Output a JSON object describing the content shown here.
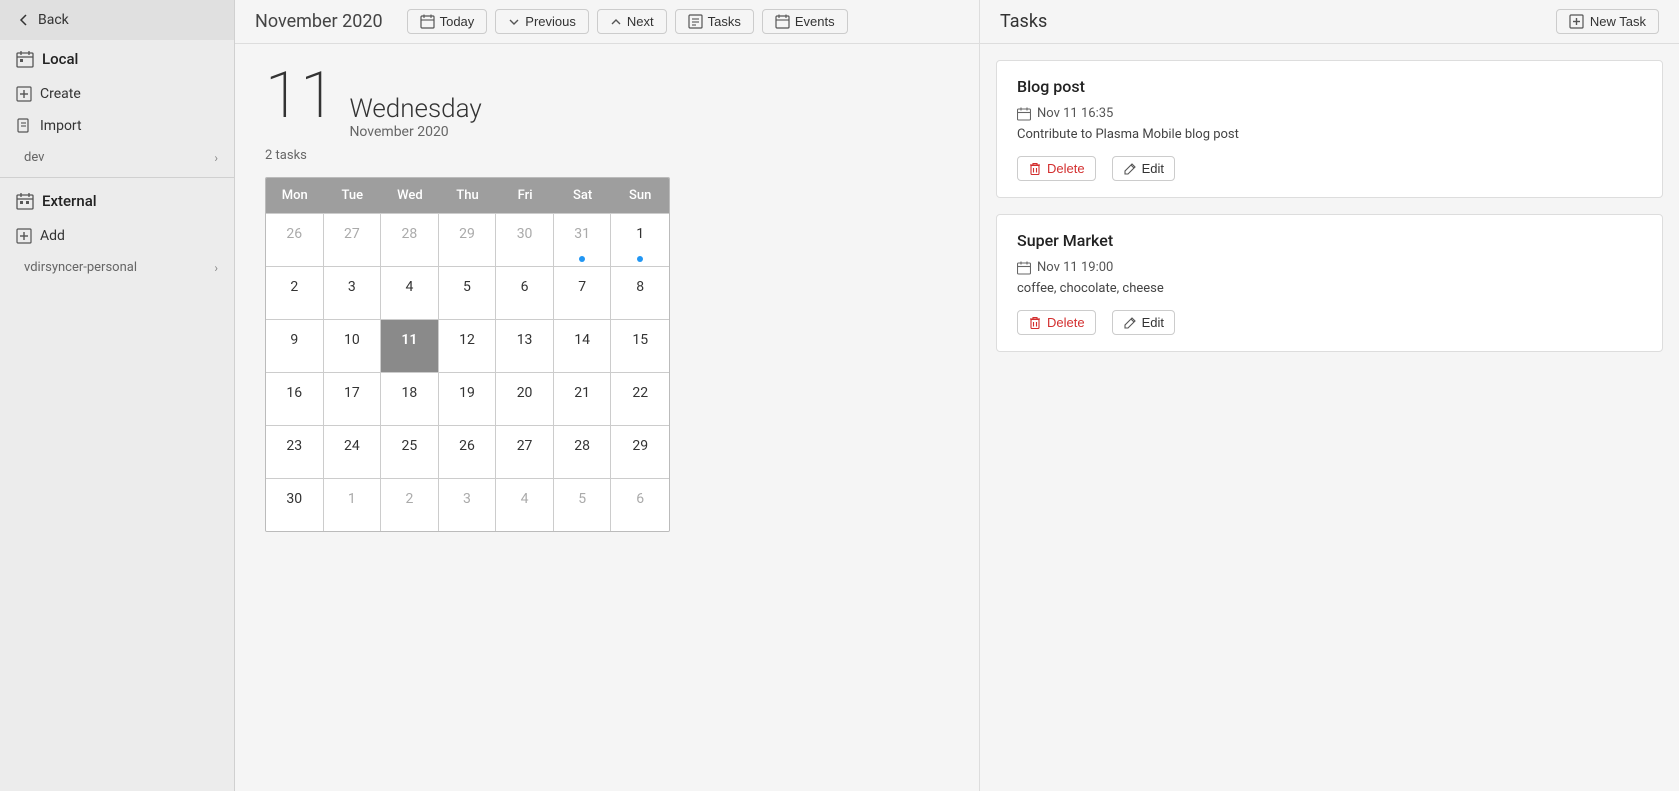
{
  "sidebar": {
    "back_label": "Back",
    "local_label": "Local",
    "create_label": "Create",
    "import_label": "Import",
    "dev_label": "dev",
    "external_label": "External",
    "add_label": "Add",
    "vdirsyncer_label": "vdirsyncer-personal"
  },
  "topbar": {
    "title": "November 2020",
    "today_label": "Today",
    "previous_label": "Previous",
    "next_label": "Next",
    "tasks_label": "Tasks",
    "events_label": "Events"
  },
  "date_display": {
    "number": "11",
    "weekday": "Wednesday",
    "month": "November 2020",
    "tasks_count": "2 tasks"
  },
  "calendar": {
    "headers": [
      "Mon",
      "Tue",
      "Wed",
      "Thu",
      "Fri",
      "Sat",
      "Sun"
    ],
    "rows": [
      [
        {
          "day": "26",
          "type": "other"
        },
        {
          "day": "27",
          "type": "other"
        },
        {
          "day": "28",
          "type": "other"
        },
        {
          "day": "29",
          "type": "other"
        },
        {
          "day": "30",
          "type": "other",
          "dot": false
        },
        {
          "day": "31",
          "type": "other",
          "dot": true
        },
        {
          "day": "1",
          "type": "normal",
          "dot": true
        }
      ],
      [
        {
          "day": "2",
          "type": "normal"
        },
        {
          "day": "3",
          "type": "normal"
        },
        {
          "day": "4",
          "type": "normal"
        },
        {
          "day": "5",
          "type": "normal"
        },
        {
          "day": "6",
          "type": "normal"
        },
        {
          "day": "7",
          "type": "normal"
        },
        {
          "day": "8",
          "type": "normal"
        }
      ],
      [
        {
          "day": "9",
          "type": "normal"
        },
        {
          "day": "10",
          "type": "normal"
        },
        {
          "day": "11",
          "type": "today"
        },
        {
          "day": "12",
          "type": "normal"
        },
        {
          "day": "13",
          "type": "normal"
        },
        {
          "day": "14",
          "type": "normal"
        },
        {
          "day": "15",
          "type": "normal"
        }
      ],
      [
        {
          "day": "16",
          "type": "normal"
        },
        {
          "day": "17",
          "type": "normal"
        },
        {
          "day": "18",
          "type": "normal"
        },
        {
          "day": "19",
          "type": "normal"
        },
        {
          "day": "20",
          "type": "normal"
        },
        {
          "day": "21",
          "type": "normal"
        },
        {
          "day": "22",
          "type": "normal"
        }
      ],
      [
        {
          "day": "23",
          "type": "normal"
        },
        {
          "day": "24",
          "type": "normal"
        },
        {
          "day": "25",
          "type": "normal"
        },
        {
          "day": "26",
          "type": "normal"
        },
        {
          "day": "27",
          "type": "normal"
        },
        {
          "day": "28",
          "type": "normal"
        },
        {
          "day": "29",
          "type": "normal"
        }
      ],
      [
        {
          "day": "30",
          "type": "normal"
        },
        {
          "day": "1",
          "type": "other"
        },
        {
          "day": "2",
          "type": "other"
        },
        {
          "day": "3",
          "type": "other"
        },
        {
          "day": "4",
          "type": "other"
        },
        {
          "day": "5",
          "type": "other"
        },
        {
          "day": "6",
          "type": "other"
        }
      ]
    ]
  },
  "tasks_panel": {
    "title": "Tasks",
    "new_task_label": "New Task",
    "tasks": [
      {
        "id": "task1",
        "title": "Blog post",
        "datetime": "Nov 11 16:35",
        "description": "Contribute to Plasma Mobile blog post",
        "delete_label": "Delete",
        "edit_label": "Edit"
      },
      {
        "id": "task2",
        "title": "Super Market",
        "datetime": "Nov 11 19:00",
        "description": "coffee, chocolate, cheese",
        "delete_label": "Delete",
        "edit_label": "Edit"
      }
    ]
  }
}
